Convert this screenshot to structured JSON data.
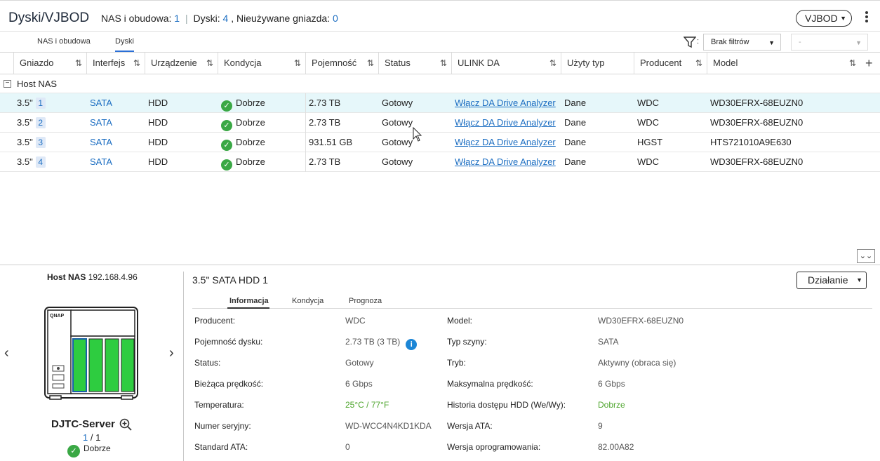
{
  "header": {
    "title": "Dyski/VJBOD",
    "nas_label": "NAS i obudowa:",
    "nas_count": "1",
    "disks_label": "Dyski:",
    "disks_count": "4",
    "unused_label": ", Nieużywane gniazda:",
    "unused_count": "0",
    "vjbod_button": "VJBOD"
  },
  "tabs": [
    {
      "label": "NAS i obudowa",
      "active": false
    },
    {
      "label": "Dyski",
      "active": true
    }
  ],
  "filter": {
    "selected": "Brak filtrów",
    "secondary": "-"
  },
  "columns": [
    "Gniazdo",
    "Interfejs",
    "Urządzenie",
    "Kondycja",
    "Pojemność",
    "Status",
    "ULINK DA",
    "Użyty typ",
    "Producent",
    "Model"
  ],
  "group": "Host NAS",
  "rows": [
    {
      "slot": "3.5\"",
      "slot_num": "1",
      "interface": "SATA",
      "device": "HDD",
      "health": "Dobrze",
      "capacity": "2.73 TB",
      "status": "Gotowy",
      "ulink": "Włącz DA Drive Analyzer",
      "used_type": "Dane",
      "vendor": "WDC",
      "model": "WD30EFRX-68EUZN0"
    },
    {
      "slot": "3.5\"",
      "slot_num": "2",
      "interface": "SATA",
      "device": "HDD",
      "health": "Dobrze",
      "capacity": "2.73 TB",
      "status": "Gotowy",
      "ulink": "Włącz DA Drive Analyzer",
      "used_type": "Dane",
      "vendor": "WDC",
      "model": "WD30EFRX-68EUZN0"
    },
    {
      "slot": "3.5\"",
      "slot_num": "3",
      "interface": "SATA",
      "device": "HDD",
      "health": "Dobrze",
      "capacity": "931.51 GB",
      "status": "Gotowy",
      "ulink": "Włącz DA Drive Analyzer",
      "used_type": "Dane",
      "vendor": "HGST",
      "model": "HTS721010A9E630"
    },
    {
      "slot": "3.5\"",
      "slot_num": "4",
      "interface": "SATA",
      "device": "HDD",
      "health": "Dobrze",
      "capacity": "2.73 TB",
      "status": "Gotowy",
      "ulink": "Włącz DA Drive Analyzer",
      "used_type": "Dane",
      "vendor": "WDC",
      "model": "WD30EFRX-68EUZN0"
    }
  ],
  "left_panel": {
    "host_label": "Host NAS",
    "host_ip": "192.168.4.96",
    "server_name": "DJTC-Server",
    "page_current": "1",
    "page_total": "/ 1",
    "status": "Dobrze",
    "brand": "QNAP"
  },
  "detail": {
    "title": "3.5\" SATA HDD 1",
    "action_button": "Działanie",
    "tabs": [
      "Informacja",
      "Kondycja",
      "Prognoza"
    ],
    "left": [
      {
        "label": "Producent:",
        "value": "WDC"
      },
      {
        "label": "Pojemność dysku:",
        "value": "2.73 TB (3 TB)"
      },
      {
        "label": "Status:",
        "value": "Gotowy"
      },
      {
        "label": "Bieżąca prędkość:",
        "value": "6 Gbps"
      },
      {
        "label": "Temperatura:",
        "value": "25°C / 77°F"
      },
      {
        "label": "Numer seryjny:",
        "value": "WD-WCC4N4KD1KDA"
      },
      {
        "label": "Standard ATA:",
        "value": "0"
      }
    ],
    "right": [
      {
        "label": "Model:",
        "value": "WD30EFRX-68EUZN0"
      },
      {
        "label": "Typ szyny:",
        "value": "SATA"
      },
      {
        "label": "Tryb:",
        "value": "Aktywny (obraca się)"
      },
      {
        "label": "Maksymalna prędkość:",
        "value": "6 Gbps"
      },
      {
        "label": "Historia dostępu HDD (We/Wy):",
        "value": "Dobrze"
      },
      {
        "label": "Wersja ATA:",
        "value": "9"
      },
      {
        "label": "Wersja oprogramowania:",
        "value": "82.00A82"
      }
    ]
  },
  "colors": {
    "accent": "#1c6ec2",
    "selected_row": "#e6f7fa",
    "ok_green": "#3aa845",
    "disk_green": "#2ecc40"
  }
}
